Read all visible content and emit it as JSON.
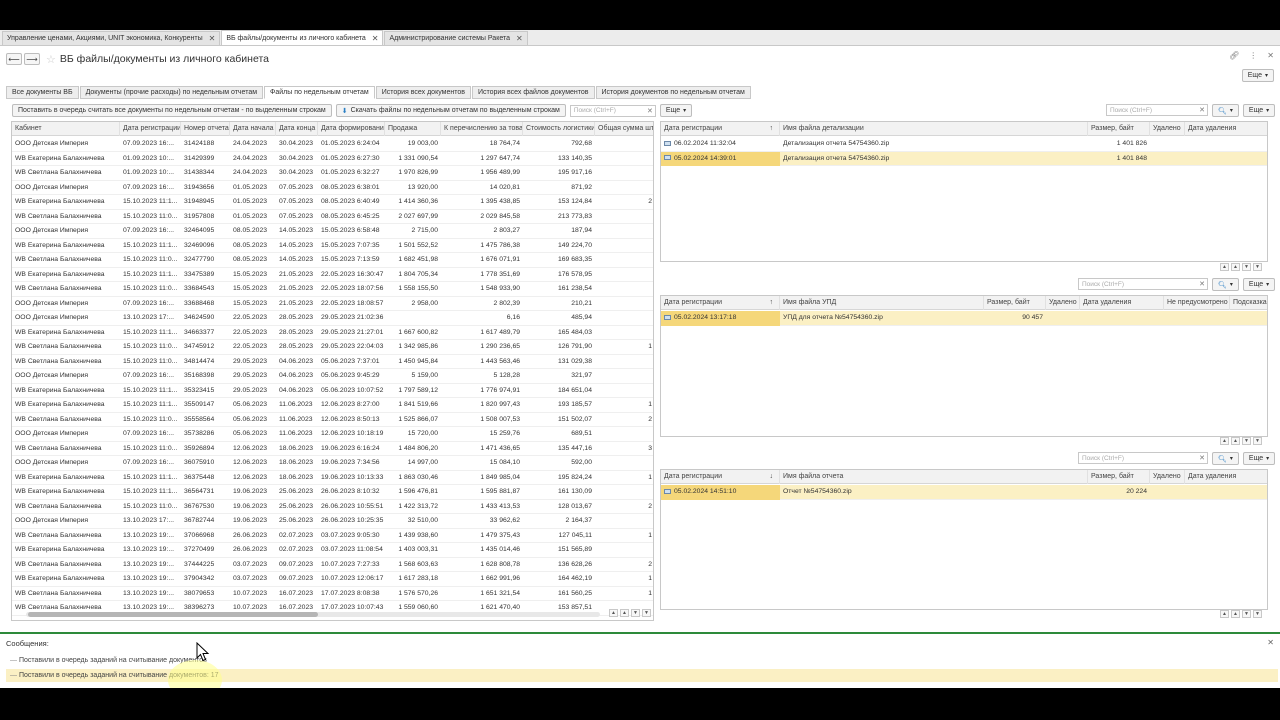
{
  "window_tabs": [
    {
      "label": "Управление ценами, Акциями, UNIT экономика, Конкуренты",
      "active": false
    },
    {
      "label": "ВБ файлы/документы из личного кабинета",
      "active": true
    },
    {
      "label": "Администрирование системы Ракета",
      "active": false
    }
  ],
  "page_title": "ВБ файлы/документы из личного кабинета",
  "more_label": "Еще",
  "form_tabs": [
    {
      "label": "Все документы ВБ",
      "active": false
    },
    {
      "label": "Документы (прочие расходы) по недельным отчетам",
      "active": false
    },
    {
      "label": "Файлы по недельным отчетам",
      "active": true
    },
    {
      "label": "История всех документов",
      "active": false
    },
    {
      "label": "История всех файлов документов",
      "active": false
    },
    {
      "label": "История документов по недельным отчетам",
      "active": false
    }
  ],
  "toolbar": {
    "queue_button": "Поставить в очередь считать все документы по недельным отчетам - по выделенным строкам",
    "download_button": "Скачать файлы по недельным отчетам по выделенным строкам",
    "search_placeholder": "Поиск (Ctrl+F)",
    "more": "Еще"
  },
  "left_table": {
    "columns": [
      "Кабинет",
      "Дата регистрации",
      "Номер отчета",
      "Дата начала",
      "Дата конца",
      "Дата формирования",
      "Продажа",
      "К перечислению за товар",
      "Стоимость логистики",
      "Общая сумма шт"
    ],
    "rows": [
      [
        "ООО Детская Империя",
        "07.09.2023 16:...",
        "31424188",
        "24.04.2023",
        "30.04.2023",
        "01.05.2023 6:24:04",
        "19 003,00",
        "18 764,74",
        "792,68",
        ""
      ],
      [
        "WB Екатерина Балахничева",
        "01.09.2023 10:...",
        "31429399",
        "24.04.2023",
        "30.04.2023",
        "01.05.2023 6:27:30",
        "1 331 090,54",
        "1 297 647,74",
        "133 140,35",
        ""
      ],
      [
        "WB Светлана Балахничева",
        "01.09.2023 10:...",
        "31438344",
        "24.04.2023",
        "30.04.2023",
        "01.05.2023 6:32:27",
        "1 970 826,99",
        "1 956 489,99",
        "195 917,16",
        ""
      ],
      [
        "ООО Детская Империя",
        "07.09.2023 16:...",
        "31943656",
        "01.05.2023",
        "07.05.2023",
        "08.05.2023 6:38:01",
        "13 920,00",
        "14 020,81",
        "871,92",
        ""
      ],
      [
        "WB Екатерина Балахничева",
        "15.10.2023 11:1...",
        "31948945",
        "01.05.2023",
        "07.05.2023",
        "08.05.2023 6:40:49",
        "1 414 360,36",
        "1 395 438,85",
        "153 124,84",
        "2"
      ],
      [
        "WB Светлана Балахничева",
        "15.10.2023 11:0...",
        "31957808",
        "01.05.2023",
        "07.05.2023",
        "08.05.2023 6:45:25",
        "2 027 697,99",
        "2 029 845,58",
        "213 773,83",
        ""
      ],
      [
        "ООО Детская Империя",
        "07.09.2023 16:...",
        "32464095",
        "08.05.2023",
        "14.05.2023",
        "15.05.2023 6:58:48",
        "2 715,00",
        "2 803,27",
        "187,94",
        ""
      ],
      [
        "WB Екатерина Балахничева",
        "15.10.2023 11:1...",
        "32469096",
        "08.05.2023",
        "14.05.2023",
        "15.05.2023 7:07:35",
        "1 501 552,52",
        "1 475 786,38",
        "149 224,70",
        ""
      ],
      [
        "WB Светлана Балахничева",
        "15.10.2023 11:0...",
        "32477790",
        "08.05.2023",
        "14.05.2023",
        "15.05.2023 7:13:59",
        "1 682 451,98",
        "1 676 071,91",
        "169 683,35",
        ""
      ],
      [
        "WB Екатерина Балахничева",
        "15.10.2023 11:1...",
        "33475389",
        "15.05.2023",
        "21.05.2023",
        "22.05.2023 16:30:47",
        "1 804 705,34",
        "1 778 351,69",
        "176 578,95",
        ""
      ],
      [
        "WB Светлана Балахничева",
        "15.10.2023 11:0...",
        "33684543",
        "15.05.2023",
        "21.05.2023",
        "22.05.2023 18:07:56",
        "1 558 155,50",
        "1 548 933,90",
        "161 238,54",
        ""
      ],
      [
        "ООО Детская Империя",
        "07.09.2023 16:...",
        "33688468",
        "15.05.2023",
        "21.05.2023",
        "22.05.2023 18:08:57",
        "2 958,00",
        "2 802,39",
        "210,21",
        ""
      ],
      [
        "ООО Детская Империя",
        "13.10.2023 17:...",
        "34624590",
        "22.05.2023",
        "28.05.2023",
        "29.05.2023 21:02:36",
        "",
        "6,16",
        "485,94",
        ""
      ],
      [
        "WB Екатерина Балахничева",
        "15.10.2023 11:1...",
        "34663377",
        "22.05.2023",
        "28.05.2023",
        "29.05.2023 21:27:01",
        "1 667 600,82",
        "1 617 489,79",
        "165 484,03",
        ""
      ],
      [
        "WB Светлана Балахничева",
        "15.10.2023 11:0...",
        "34745912",
        "22.05.2023",
        "28.05.2023",
        "29.05.2023 22:04:03",
        "1 342 985,86",
        "1 290 236,65",
        "126 791,90",
        "1"
      ],
      [
        "WB Светлана Балахничева",
        "15.10.2023 11:0...",
        "34814474",
        "29.05.2023",
        "04.06.2023",
        "05.06.2023 7:37:01",
        "1 450 945,84",
        "1 443 563,46",
        "131 029,38",
        ""
      ],
      [
        "ООО Детская Империя",
        "07.09.2023 16:...",
        "35168398",
        "29.05.2023",
        "04.06.2023",
        "05.06.2023 9:45:29",
        "5 159,00",
        "5 128,28",
        "321,97",
        ""
      ],
      [
        "WB Екатерина Балахничева",
        "15.10.2023 11:1...",
        "35323415",
        "29.05.2023",
        "04.06.2023",
        "05.06.2023 10:07:52",
        "1 797 589,12",
        "1 776 974,91",
        "184 651,04",
        ""
      ],
      [
        "WB Екатерина Балахничева",
        "15.10.2023 11:1...",
        "35509147",
        "05.06.2023",
        "11.06.2023",
        "12.06.2023 8:27:00",
        "1 841 519,66",
        "1 820 997,43",
        "193 185,57",
        "1"
      ],
      [
        "WB Светлана Балахничева",
        "15.10.2023 11:0...",
        "35558564",
        "05.06.2023",
        "11.06.2023",
        "12.06.2023 8:50:13",
        "1 525 866,07",
        "1 508 007,53",
        "151 502,07",
        "2"
      ],
      [
        "ООО Детская Империя",
        "07.09.2023 16:...",
        "35738286",
        "05.06.2023",
        "11.06.2023",
        "12.06.2023 10:18:19",
        "15 720,00",
        "15 259,76",
        "689,51",
        ""
      ],
      [
        "WB Светлана Балахничева",
        "15.10.2023 11:0...",
        "35926894",
        "12.06.2023",
        "18.06.2023",
        "19.06.2023 6:16:24",
        "1 484 806,20",
        "1 471 436,65",
        "135 447,16",
        "3"
      ],
      [
        "ООО Детская Империя",
        "07.09.2023 16:...",
        "36075910",
        "12.06.2023",
        "18.06.2023",
        "19.06.2023 7:34:56",
        "14 997,00",
        "15 084,10",
        "592,00",
        ""
      ],
      [
        "WB Екатерина Балахничева",
        "15.10.2023 11:1...",
        "36375448",
        "12.06.2023",
        "18.06.2023",
        "19.06.2023 10:13:33",
        "1 863 030,46",
        "1 849 985,04",
        "195 824,24",
        "1"
      ],
      [
        "WB Екатерина Балахничева",
        "15.10.2023 11:1...",
        "36564731",
        "19.06.2023",
        "25.06.2023",
        "26.06.2023 8:10:32",
        "1 596 476,81",
        "1 595 881,87",
        "161 130,09",
        ""
      ],
      [
        "WB Светлана Балахничева",
        "15.10.2023 11:0...",
        "36767530",
        "19.06.2023",
        "25.06.2023",
        "26.06.2023 10:55:51",
        "1 422 313,72",
        "1 433 413,53",
        "128 013,67",
        "2"
      ],
      [
        "ООО Детская Империя",
        "13.10.2023 17:...",
        "36782744",
        "19.06.2023",
        "25.06.2023",
        "26.06.2023 10:25:35",
        "32 510,00",
        "33 962,62",
        "2 164,37",
        ""
      ],
      [
        "WB Светлана Балахничева",
        "13.10.2023 19:...",
        "37066968",
        "26.06.2023",
        "02.07.2023",
        "03.07.2023 9:05:30",
        "1 439 938,60",
        "1 479 375,43",
        "127 045,11",
        "1"
      ],
      [
        "WB Екатерина Балахничева",
        "13.10.2023 19:...",
        "37270499",
        "26.06.2023",
        "02.07.2023",
        "03.07.2023 11:08:54",
        "1 403 003,31",
        "1 435 014,46",
        "151 565,89",
        ""
      ],
      [
        "WB Светлана Балахничева",
        "13.10.2023 19:...",
        "37444225",
        "03.07.2023",
        "09.07.2023",
        "10.07.2023 7:27:33",
        "1 568 603,63",
        "1 628 808,78",
        "136 628,26",
        "2"
      ],
      [
        "WB Екатерина Балахничева",
        "13.10.2023 19:...",
        "37904342",
        "03.07.2023",
        "09.07.2023",
        "10.07.2023 12:06:17",
        "1 617 283,18",
        "1 662 991,96",
        "164 462,19",
        "1"
      ],
      [
        "WB Светлана Балахничева",
        "13.10.2023 19:...",
        "38079653",
        "10.07.2023",
        "16.07.2023",
        "17.07.2023 8:08:38",
        "1 576 570,26",
        "1 651 321,54",
        "161 560,25",
        "1"
      ],
      [
        "WB Светлана Балахничева",
        "13.10.2023 19:...",
        "38396273",
        "10.07.2023",
        "16.07.2023",
        "17.07.2023 10:07:43",
        "1 559 060,60",
        "1 621 470,40",
        "153 857,51",
        ""
      ]
    ]
  },
  "detail_panel": {
    "search_placeholder": "Поиск (Ctrl+F)",
    "more": "Еще",
    "columns": [
      "Дата регистрации",
      "Имя файла детализации",
      "Размер, байт",
      "Удалено",
      "Дата удаления"
    ],
    "sort_mark": "↑",
    "rows": [
      {
        "date": "06.02.2024 11:32:04",
        "name": "Детализация отчета 54754360.zip",
        "size": "1 401 826",
        "deleted": "",
        "del_date": "",
        "selected": false
      },
      {
        "date": "05.02.2024 14:39:01",
        "name": "Детализация отчета 54754360.zip",
        "size": "1 401 848",
        "deleted": "",
        "del_date": "",
        "selected": true
      }
    ]
  },
  "upd_panel": {
    "search_placeholder": "Поиск (Ctrl+F)",
    "more": "Еще",
    "columns": [
      "Дата регистрации",
      "Имя файла УПД",
      "Размер, байт",
      "Удалено",
      "Дата удаления",
      "Не предусмотрено",
      "Подсказка"
    ],
    "sort_mark": "↑",
    "rows": [
      {
        "date": "05.02.2024 13:17:18",
        "name": "УПД для отчета №54754360.zip",
        "size": "90 457",
        "selected": true
      }
    ]
  },
  "report_panel": {
    "search_placeholder": "Поиск (Ctrl+F)",
    "more": "Еще",
    "columns": [
      "Дата регистрации",
      "Имя файла отчета",
      "Размер, байт",
      "Удалено",
      "Дата удаления"
    ],
    "sort_mark": "↓",
    "rows": [
      {
        "date": "05.02.2024 14:51:10",
        "name": "Отчет №54754360.zip",
        "size": "20 224",
        "selected": true
      }
    ]
  },
  "messages": {
    "title": "Сообщения:",
    "items": [
      {
        "text": "Поставили в очередь заданий на считывание документов",
        "highlight": false
      },
      {
        "text": "Поставили в очередь заданий на считывание документов: 17",
        "highlight": true
      }
    ]
  },
  "colors": {
    "accent_green": "#2d8a3a",
    "selection": "#fbf0c4",
    "selected_cell": "#f5d77a"
  }
}
